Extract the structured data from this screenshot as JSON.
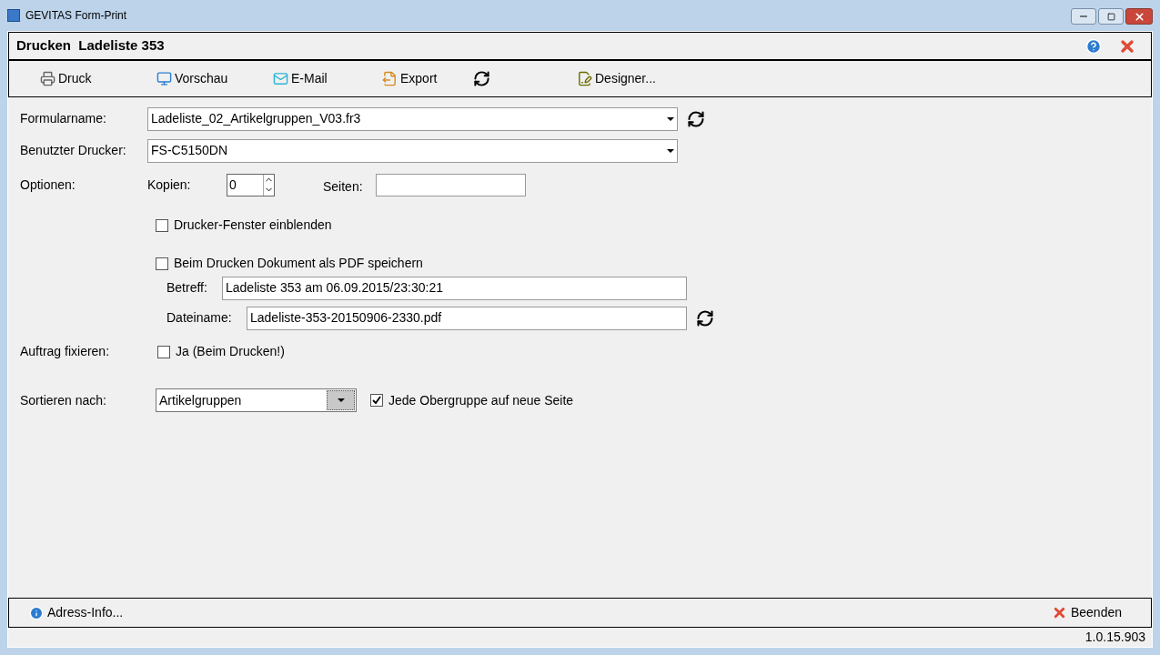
{
  "window": {
    "title": "GEVITAS Form-Print"
  },
  "header": {
    "title": "Drucken  Ladeliste 353"
  },
  "toolbar": [
    {
      "kind": "print",
      "label": "Druck"
    },
    {
      "kind": "preview",
      "label": "Vorschau"
    },
    {
      "kind": "mail",
      "label": "E-Mail"
    },
    {
      "kind": "export",
      "label": "Export"
    },
    {
      "kind": "refresh"
    },
    {
      "kind": "designer",
      "label": "Designer..."
    }
  ],
  "form": {
    "formular": {
      "label": "Formularname:",
      "value": "Ladeliste_02_Artikelgruppen_V03.fr3"
    },
    "drucker": {
      "label": "Benutzter Drucker:",
      "value": "FS-C5150DN"
    },
    "optionen": {
      "label": "Optionen:",
      "kopien_label": "Kopien:",
      "kopien": "0",
      "seiten_label": "Seiten:"
    },
    "drucker_fenster": {
      "label": "Drucker-Fenster einblenden",
      "checked": false
    },
    "pdf": {
      "label": "Beim Drucken Dokument als PDF speichern",
      "checked": false
    },
    "betreff": {
      "label": "Betreff:",
      "value": "Ladeliste 353 am 06.09.2015/23:30:21"
    },
    "dateiname": {
      "label": "Dateiname:",
      "value": "Ladeliste-353-20150906-2330.pdf"
    },
    "fixieren": {
      "label": "Auftrag fixieren:",
      "option": "Ja (Beim Drucken!)",
      "checked": false
    },
    "sortieren": {
      "label": "Sortieren nach:",
      "value": "Artikelgruppen",
      "option": "Jede Obergruppe auf neue Seite",
      "checked": true
    }
  },
  "footer": {
    "info": "Adress-Info...",
    "close": "Beenden"
  },
  "status_bar": {
    "version": "1.0.15.903"
  }
}
